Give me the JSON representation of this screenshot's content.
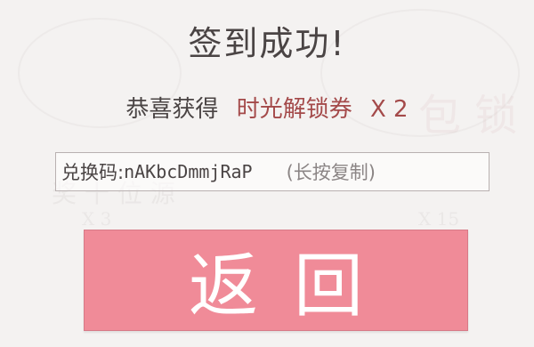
{
  "dialog": {
    "title": "签到成功!",
    "reward_prefix": "恭喜获得",
    "reward_item": "时光解锁券",
    "reward_count": "X 2",
    "code_label": "兑换码:",
    "code_value": "nAKbcDmmjRaP",
    "code_hint": "(长按复制)",
    "back_label": "返回"
  },
  "background": {
    "left_item_text": "奖 十 位 源",
    "left_item_count": "X 3",
    "right_item_text": "包 锁",
    "right_item_count": "X 15"
  },
  "colors": {
    "accent_red": "#a44a4a",
    "button_pink": "#f08b98",
    "text_dark": "#4a4444",
    "background": "#f4f2f1"
  }
}
